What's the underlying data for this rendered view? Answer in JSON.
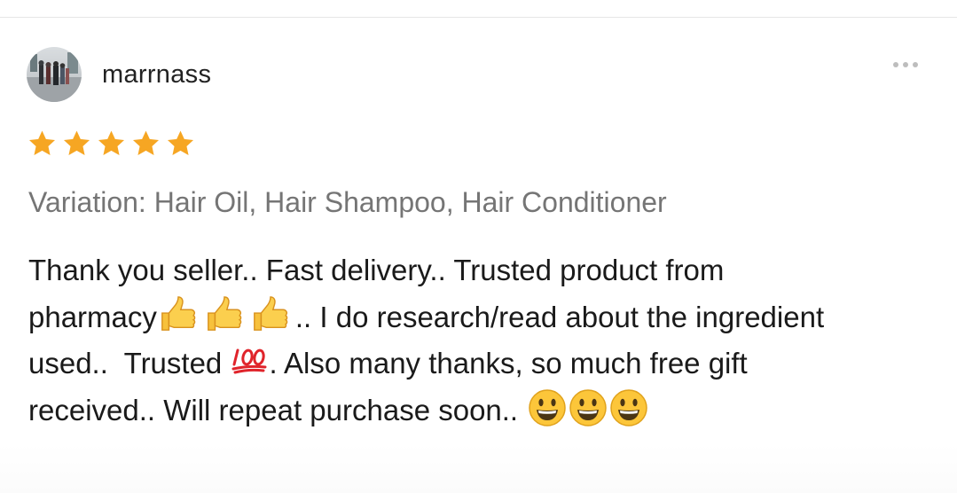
{
  "review": {
    "username": "marrnass",
    "rating": 5,
    "rating_max": 5,
    "star_color": "#f6a623",
    "variation": "Variation: Hair Oil, Hair Shampoo, Hair Conditioner",
    "comment": {
      "line1": "Thank you seller.. Fast delivery.. Trusted product from",
      "line2_a": "pharmacy",
      "line2_b": ".. I do research/read about the ingredient",
      "line3_a": "used..  Trusted ",
      "line3_b": ". Also many thanks, so much free gift",
      "line4": "received.. Will repeat purchase soon.. "
    },
    "emojis": {
      "thumbs": [
        "thumbs-up-icon",
        "thumbs-up-icon",
        "thumbs-up-icon"
      ],
      "hundred": "hundred-points-icon",
      "smiles": [
        "grinning-face-icon",
        "grinning-face-icon",
        "grinning-face-icon"
      ]
    }
  }
}
